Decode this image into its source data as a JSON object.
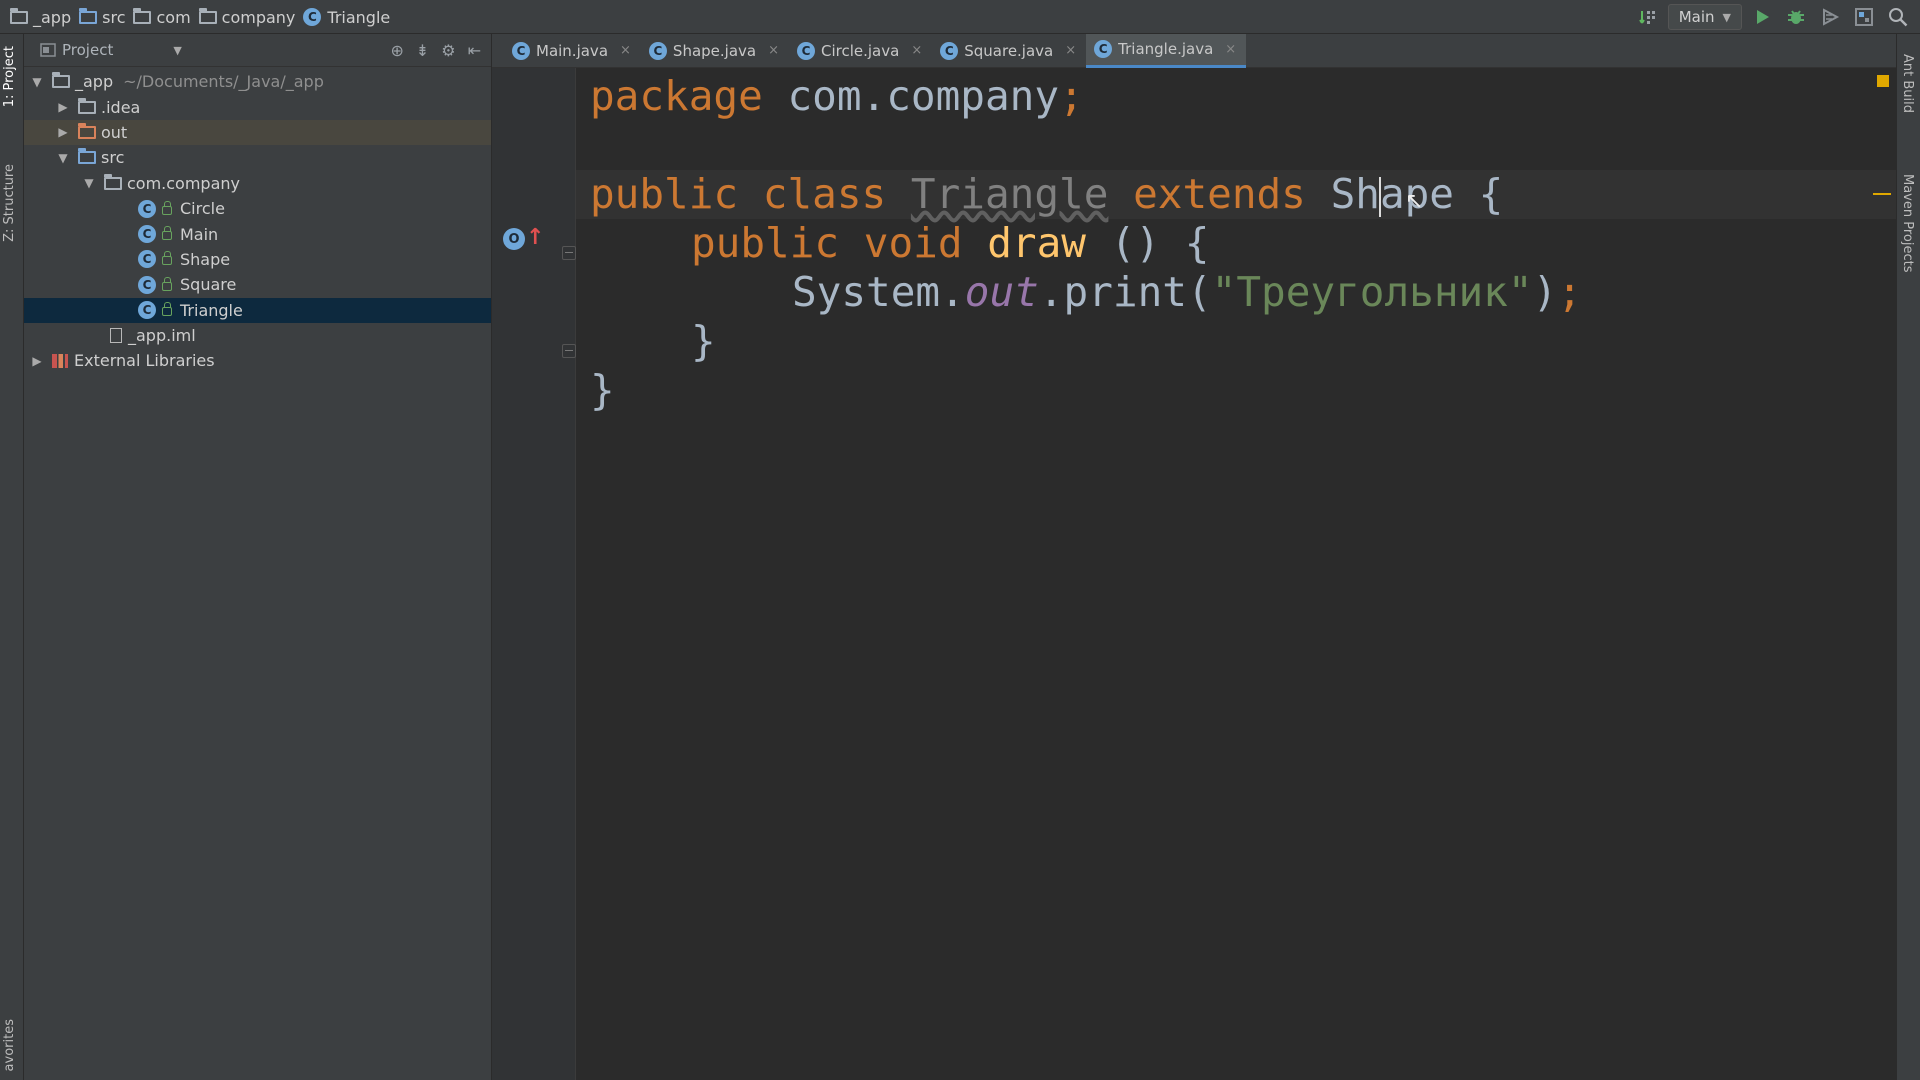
{
  "breadcrumbs": [
    {
      "label": "_app",
      "icon": "folder-icon"
    },
    {
      "label": "src",
      "icon": "folder-icon"
    },
    {
      "label": "com",
      "icon": "folder-icon"
    },
    {
      "label": "company",
      "icon": "folder-icon"
    },
    {
      "label": "Triangle",
      "icon": "class-icon"
    }
  ],
  "toolbar": {
    "run_config": "Main"
  },
  "left_tool_windows": {
    "project": "1: Project",
    "structure": "Z: Structure",
    "favorites": "avorites"
  },
  "right_tool_windows": {
    "ant_build": "Ant Build",
    "maven": "Maven Projects"
  },
  "project_panel": {
    "title": "Project",
    "tree": [
      {
        "label": "_app",
        "path": "~/Documents/_Java/_app",
        "level": 0,
        "expanded": true
      },
      {
        "label": ".idea",
        "level": 1,
        "expanded": false
      },
      {
        "label": "out",
        "level": 1,
        "expanded": false
      },
      {
        "label": "src",
        "level": 1,
        "expanded": true
      },
      {
        "label": "com.company",
        "level": 2,
        "expanded": true
      },
      {
        "label": "Circle",
        "level": 3
      },
      {
        "label": "Main",
        "level": 3
      },
      {
        "label": "Shape",
        "level": 3
      },
      {
        "label": "Square",
        "level": 3
      },
      {
        "label": "Triangle",
        "level": 3,
        "selected": true
      },
      {
        "label": "_app.iml",
        "level": 2
      },
      {
        "label": "External Libraries",
        "level": 0,
        "expanded": false
      }
    ]
  },
  "editor": {
    "tabs": [
      {
        "label": "Main.java",
        "active": false
      },
      {
        "label": "Shape.java",
        "active": false
      },
      {
        "label": "Circle.java",
        "active": false
      },
      {
        "label": "Square.java",
        "active": false
      },
      {
        "label": "Triangle.java",
        "active": true
      }
    ],
    "code": {
      "line1": {
        "kw": "package",
        "rest": " com.company",
        "semi": ";"
      },
      "line3": {
        "kw1": "public",
        "kw2": "class",
        "name": "Triangle",
        "kw3": "extends",
        "super_a": "Sh",
        "super_b": "ape",
        "brace": " {"
      },
      "line4": {
        "kw1": "public",
        "kw2": "void",
        "method": "draw",
        "rest": " () {"
      },
      "line5": {
        "obj": "System.",
        "field": "out",
        "call": ".print(",
        "str": "\"Треугольник\"",
        "close": ")",
        "semi": ";"
      },
      "line6": "}",
      "line7": "}"
    }
  },
  "colors": {
    "keyword": "#cc7832",
    "string": "#6a8759",
    "method": "#ffc66d",
    "static_field": "#9876aa",
    "selection": "#0d293e"
  }
}
